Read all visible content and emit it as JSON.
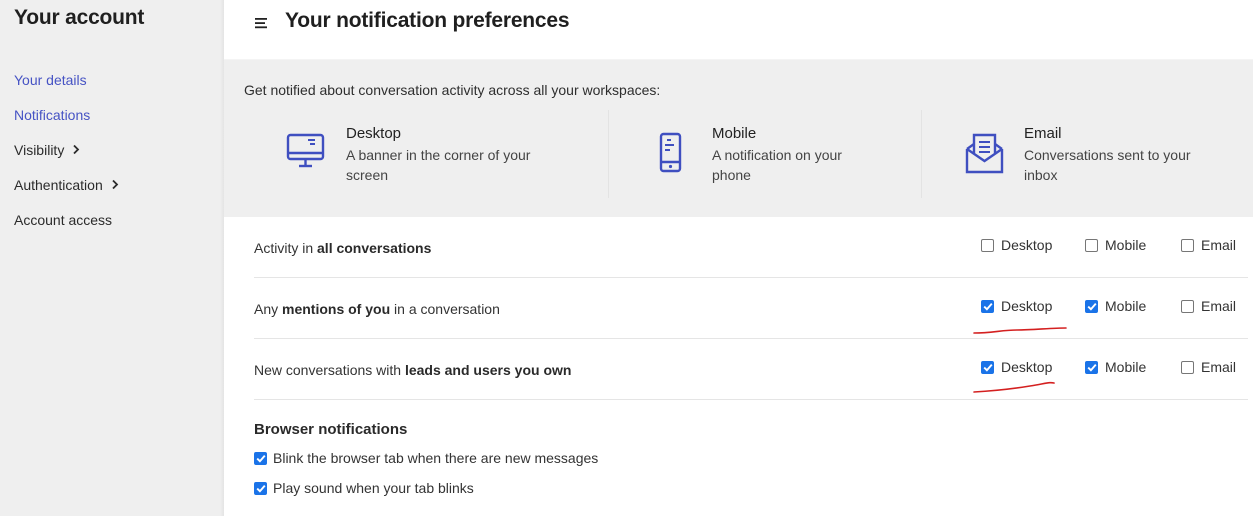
{
  "sidebar": {
    "title": "Your account",
    "items": [
      {
        "label": "Your details",
        "active": true,
        "chevron": false
      },
      {
        "label": "Notifications",
        "active": true,
        "chevron": false
      },
      {
        "label": "Visibility",
        "active": false,
        "chevron": true
      },
      {
        "label": "Authentication",
        "active": false,
        "chevron": true
      },
      {
        "label": "Account access",
        "active": false,
        "chevron": false
      }
    ]
  },
  "header": {
    "menu_icon": "hamburger-icon",
    "title": "Your notification preferences"
  },
  "intro": {
    "text": "Get notified about conversation activity across all your workspaces:",
    "channels": [
      {
        "icon": "desktop-monitor-icon",
        "title": "Desktop",
        "description": "A banner in the corner of your screen"
      },
      {
        "icon": "mobile-phone-icon",
        "title": "Mobile",
        "description": "A notification on your phone"
      },
      {
        "icon": "email-envelope-icon",
        "title": "Email",
        "description": "Conversations sent to your inbox"
      }
    ]
  },
  "preferences": {
    "option_labels": {
      "desktop": "Desktop",
      "mobile": "Mobile",
      "email": "Email"
    },
    "rows": [
      {
        "prefix": "Activity in ",
        "bold": "all conversations",
        "suffix": "",
        "desktop": false,
        "mobile": false,
        "email": false
      },
      {
        "prefix": "Any ",
        "bold": "mentions of you",
        "suffix": " in a conversation",
        "desktop": true,
        "mobile": true,
        "email": false
      },
      {
        "prefix": "New conversations with ",
        "bold": "leads and users you own",
        "suffix": "",
        "desktop": true,
        "mobile": true,
        "email": false
      }
    ]
  },
  "browser_notifications": {
    "title": "Browser notifications",
    "options": [
      {
        "label": "Blink the browser tab when there are new messages",
        "checked": true
      },
      {
        "label": "Play sound when your tab blinks",
        "checked": true
      }
    ]
  },
  "colors": {
    "accent": "#4653c4",
    "checkbox": "#1a73e8",
    "annotation": "#d42020"
  }
}
